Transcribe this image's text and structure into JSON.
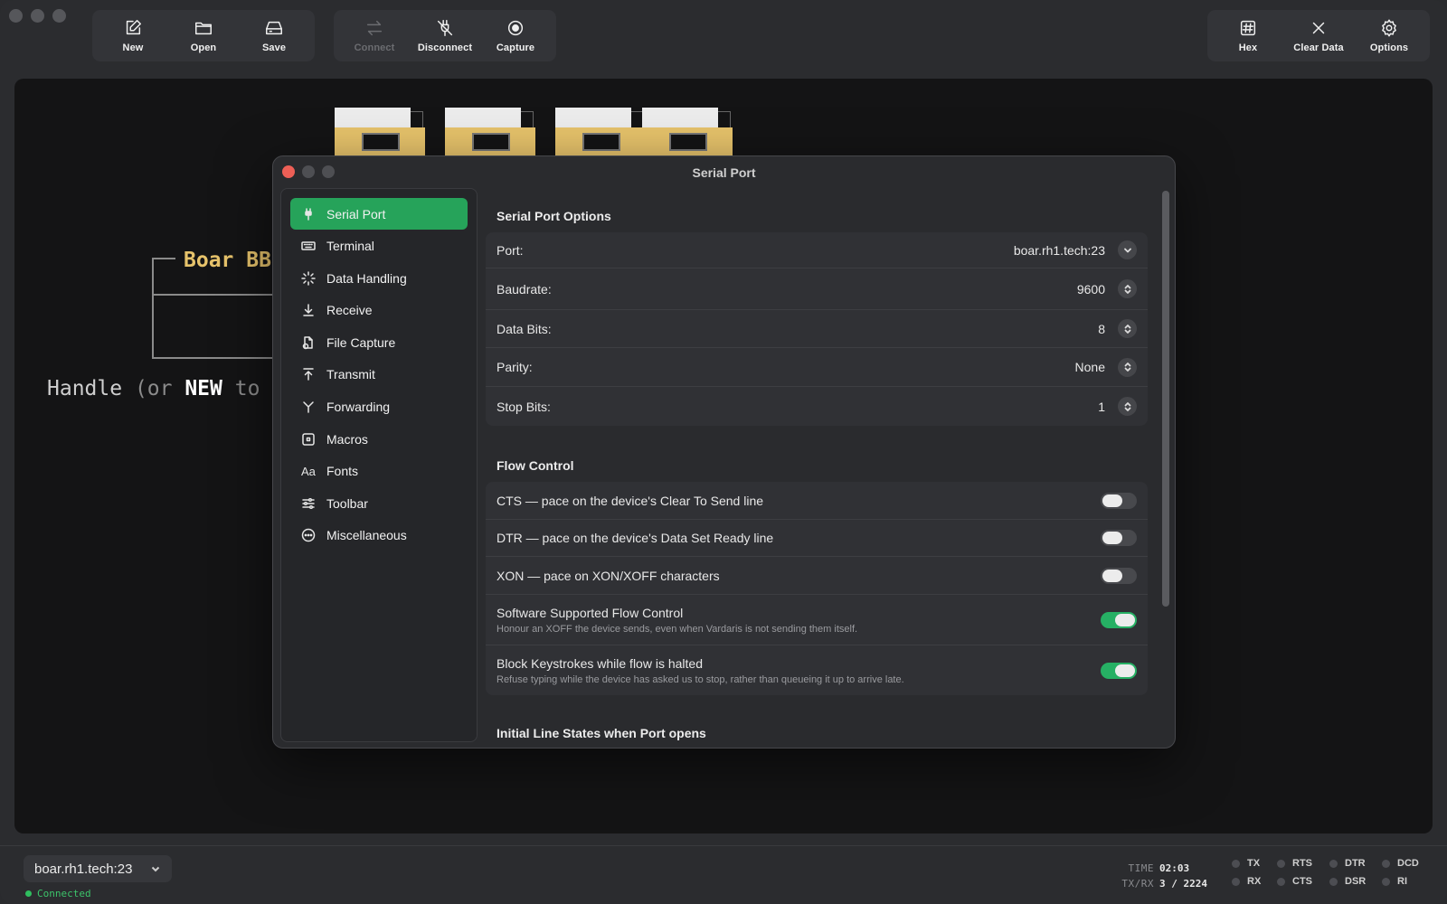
{
  "toolbar": {
    "file": [
      {
        "label": "New",
        "icon": "new-document-icon"
      },
      {
        "label": "Open",
        "icon": "folder-icon"
      },
      {
        "label": "Save",
        "icon": "drive-icon"
      }
    ],
    "connection": [
      {
        "label": "Connect",
        "icon": "connect-arrows-icon",
        "enabled": false
      },
      {
        "label": "Disconnect",
        "icon": "disconnect-plug-icon",
        "enabled": true
      },
      {
        "label": "Capture",
        "icon": "record-icon",
        "enabled": true
      }
    ],
    "view": [
      {
        "label": "Hex",
        "icon": "hash-icon"
      },
      {
        "label": "Clear Data",
        "icon": "x-icon"
      },
      {
        "label": "Options",
        "icon": "gear-icon"
      }
    ]
  },
  "terminal": {
    "title_text": "Boar BB",
    "line_prefix": "Handle ",
    "line_paren": "(or ",
    "line_bold": "NEW",
    "line_suffix": " to"
  },
  "dialog": {
    "title": "Serial Port",
    "sidebar": [
      {
        "label": "Serial Port",
        "icon": "plug-icon",
        "active": true
      },
      {
        "label": "Terminal",
        "icon": "keyboard-icon"
      },
      {
        "label": "Data Handling",
        "icon": "sparkle-icon"
      },
      {
        "label": "Receive",
        "icon": "download-arrow-icon"
      },
      {
        "label": "File Capture",
        "icon": "file-capture-icon"
      },
      {
        "label": "Transmit",
        "icon": "upload-arrow-icon"
      },
      {
        "label": "Forwarding",
        "icon": "fork-icon"
      },
      {
        "label": "Macros",
        "icon": "command-key-icon"
      },
      {
        "label": "Fonts",
        "icon": "font-icon",
        "glyph": "Aa"
      },
      {
        "label": "Toolbar",
        "icon": "sliders-icon"
      },
      {
        "label": "Miscellaneous",
        "icon": "ellipsis-circle-icon"
      }
    ],
    "serial_options": {
      "heading": "Serial Port Options",
      "port_label": "Port:",
      "port_value": "boar.rh1.tech:23",
      "baud_label": "Baudrate:",
      "baud_value": "9600",
      "databits_label": "Data Bits:",
      "databits_value": "8",
      "parity_label": "Parity:",
      "parity_value": "None",
      "stopbits_label": "Stop Bits:",
      "stopbits_value": "1"
    },
    "flow_control": {
      "heading": "Flow Control",
      "cts_label": "CTS — pace on the device's Clear To Send line",
      "cts_on": false,
      "dtr_label": "DTR — pace on the device's Data Set Ready line",
      "dtr_on": false,
      "xon_label": "XON — pace on XON/XOFF characters",
      "xon_on": false,
      "soft_label": "Software Supported Flow Control",
      "soft_sub": "Honour an XOFF the device sends, even when Vardaris is not sending them itself.",
      "soft_on": true,
      "block_label": "Block Keystrokes while flow is halted",
      "block_sub": "Refuse typing while the device has asked us to stop, rather than queueing it up to arrive late.",
      "block_on": true
    },
    "initial_lines": {
      "heading": "Initial Line States when Port opens"
    }
  },
  "statusbar": {
    "port": "boar.rh1.tech:23",
    "connection_status": "Connected",
    "time_label": "TIME",
    "time_value": "02:03",
    "txrx_label": "TX/RX",
    "txrx_value": "3 / 2224",
    "lines": [
      "TX",
      "RTS",
      "DTR",
      "DCD",
      "RX",
      "CTS",
      "DSR",
      "RI"
    ]
  },
  "colors": {
    "accent": "#26a35a",
    "connected": "#2fbf5f",
    "terminal_title": "#e7c36b"
  }
}
